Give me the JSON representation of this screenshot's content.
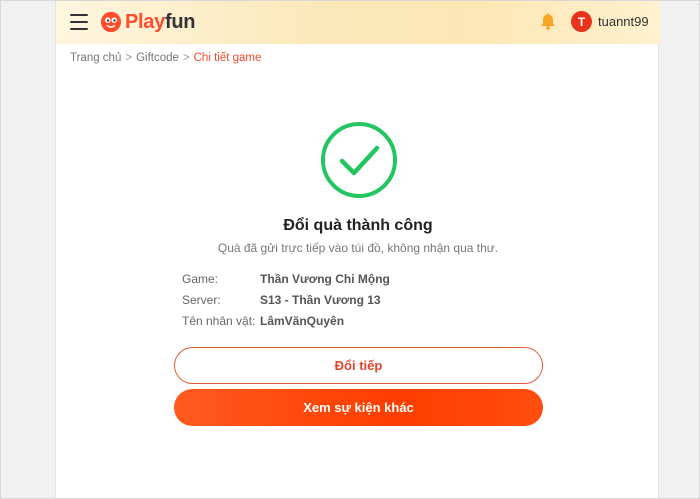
{
  "header": {
    "logo_part1": "Play",
    "logo_part2": "fun",
    "avatar_initial": "T",
    "username": "tuannt99"
  },
  "breadcrumb": {
    "items": [
      "Trang chủ",
      "Giftcode"
    ],
    "separator": ">",
    "current": "Chi tiết game"
  },
  "result": {
    "title": "Đổi quà thành công",
    "subtitle": "Quà đã gửi trực tiếp vào túi đồ, không nhận qua thư.",
    "details": [
      {
        "label": "Game:",
        "value": "Thần Vương Chi Mộng"
      },
      {
        "label": "Server:",
        "value": "S13 - Thần Vương 13"
      },
      {
        "label": "Tên nhân vật:",
        "value": "LâmVănQuyên"
      }
    ]
  },
  "actions": {
    "continue_label": "Đổi tiếp",
    "other_events_label": "Xem sự kiện khác"
  },
  "icons": {
    "menu": "menu-icon",
    "logo": "playfun-logo-icon",
    "bell": "bell-icon",
    "success": "success-check-icon"
  },
  "colors": {
    "brand": "#ff4d2e",
    "success": "#22c55e",
    "accent_orange": "#ff4a10",
    "bell": "#f5a623"
  }
}
